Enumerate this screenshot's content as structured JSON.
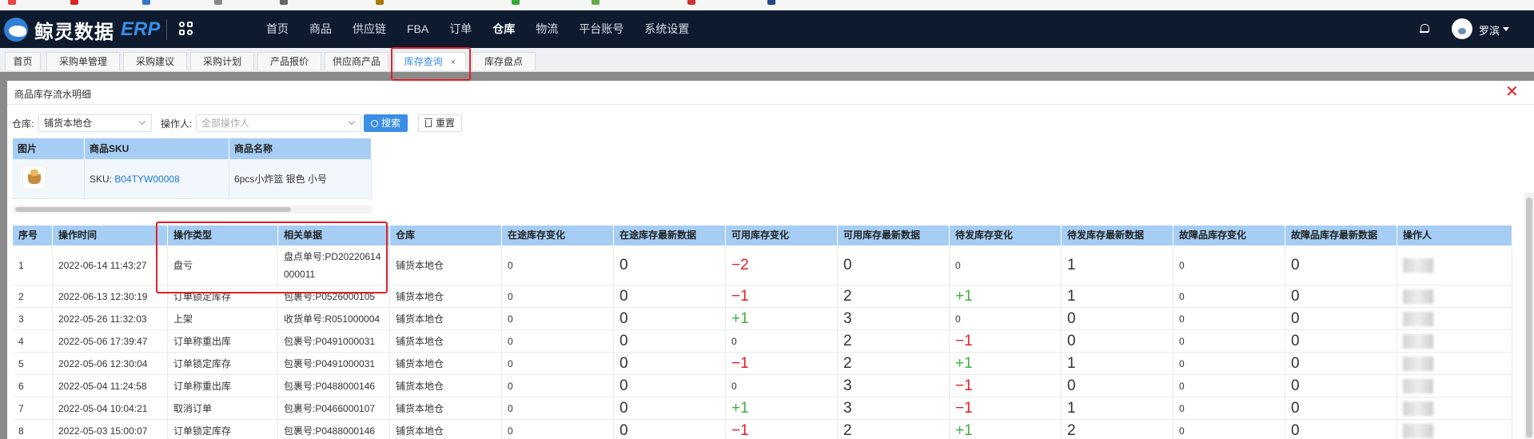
{
  "topbar": {
    "logo_text": "鲸灵数据",
    "logo_erp": "ERP",
    "nav": [
      "首页",
      "商品",
      "供应链",
      "FBA",
      "订单",
      "仓库",
      "物流",
      "平台账号",
      "系统设置"
    ],
    "active_nav": "仓库",
    "username": "罗滨"
  },
  "tabs": [
    {
      "label": "首页"
    },
    {
      "label": "采购单管理"
    },
    {
      "label": "采购建议"
    },
    {
      "label": "采购计划"
    },
    {
      "label": "产品报价"
    },
    {
      "label": "供应商产品"
    },
    {
      "label": "库存查询",
      "active": true,
      "close": "×"
    },
    {
      "label": "库存盘点"
    }
  ],
  "panel": {
    "title": "商品库存流水明细",
    "close": "✕"
  },
  "filters": {
    "warehouse_label": "仓库:",
    "warehouse_value": "铺货本地仓",
    "operator_label": "操作人:",
    "operator_placeholder": "全部操作人",
    "search_label": "搜索",
    "reset_label": "重置"
  },
  "product": {
    "headers": [
      "图片",
      "商品SKU",
      "商品名称"
    ],
    "sku_prefix": "SKU:",
    "sku": "B04TYW00008",
    "name": "6pcs小炸篮 银色 小号"
  },
  "table": {
    "headers": [
      "序号",
      "操作时间",
      "操作类型",
      "相关单据",
      "仓库",
      "在途库存变化",
      "在途库存最新数据",
      "可用库存变化",
      "可用库存最新数据",
      "待发库存变化",
      "待发库存最新数据",
      "故障品库存变化",
      "故障品库存最新数据",
      "操作人"
    ],
    "rows": [
      {
        "idx": "1",
        "time": "2022-06-14 11:43:27",
        "type": "盘亏",
        "doc": "盘点单号:PD20220614000011",
        "wh": "铺货本地仓",
        "tr_chg": "0",
        "tr_new": "0",
        "av_chg": "−2",
        "av_new": "0",
        "pd_chg": "0",
        "pd_new": "1",
        "df_chg": "0",
        "df_new": "0"
      },
      {
        "idx": "2",
        "time": "2022-06-13 12:30:19",
        "type": "订单锁定库存",
        "doc": "包裹号:P0526000105",
        "wh": "铺货本地仓",
        "tr_chg": "0",
        "tr_new": "0",
        "av_chg": "−1",
        "av_new": "2",
        "pd_chg": "+1",
        "pd_new": "1",
        "df_chg": "0",
        "df_new": "0"
      },
      {
        "idx": "3",
        "time": "2022-05-26 11:32:03",
        "type": "上架",
        "doc": "收货单号:R051000004",
        "wh": "铺货本地仓",
        "tr_chg": "0",
        "tr_new": "0",
        "av_chg": "+1",
        "av_new": "3",
        "pd_chg": "0",
        "pd_new": "0",
        "df_chg": "0",
        "df_new": "0"
      },
      {
        "idx": "4",
        "time": "2022-05-06 17:39:47",
        "type": "订单称重出库",
        "doc": "包裹号:P0491000031",
        "wh": "铺货本地仓",
        "tr_chg": "0",
        "tr_new": "0",
        "av_chg": "0",
        "av_new": "2",
        "pd_chg": "−1",
        "pd_new": "0",
        "df_chg": "0",
        "df_new": "0"
      },
      {
        "idx": "5",
        "time": "2022-05-06 12:30:04",
        "type": "订单锁定库存",
        "doc": "包裹号:P0491000031",
        "wh": "铺货本地仓",
        "tr_chg": "0",
        "tr_new": "0",
        "av_chg": "−1",
        "av_new": "2",
        "pd_chg": "+1",
        "pd_new": "1",
        "df_chg": "0",
        "df_new": "0"
      },
      {
        "idx": "6",
        "time": "2022-05-04 11:24:58",
        "type": "订单称重出库",
        "doc": "包裹号:P0488000146",
        "wh": "铺货本地仓",
        "tr_chg": "0",
        "tr_new": "0",
        "av_chg": "0",
        "av_new": "3",
        "pd_chg": "−1",
        "pd_new": "0",
        "df_chg": "0",
        "df_new": "0"
      },
      {
        "idx": "7",
        "time": "2022-05-04 10:04:21",
        "type": "取消订单",
        "doc": "包裹号:P0466000107",
        "wh": "铺货本地仓",
        "tr_chg": "0",
        "tr_new": "0",
        "av_chg": "+1",
        "av_new": "3",
        "pd_chg": "−1",
        "pd_new": "1",
        "df_chg": "0",
        "df_new": "0"
      },
      {
        "idx": "8",
        "time": "2022-05-03 15:00:07",
        "type": "订单锁定库存",
        "doc": "包裹号:P0488000146",
        "wh": "铺货本地仓",
        "tr_chg": "0",
        "tr_new": "0",
        "av_chg": "−1",
        "av_new": "2",
        "pd_chg": "+1",
        "pd_new": "2",
        "df_chg": "0",
        "df_new": "0"
      }
    ]
  },
  "colors": {
    "accent": "#3a8ee6",
    "header_bg": "#a6cef4",
    "topbar_bg": "#0e1a2e",
    "negative": "#e0202a",
    "positive": "#3fae3f",
    "highlight": "#e0202a"
  }
}
